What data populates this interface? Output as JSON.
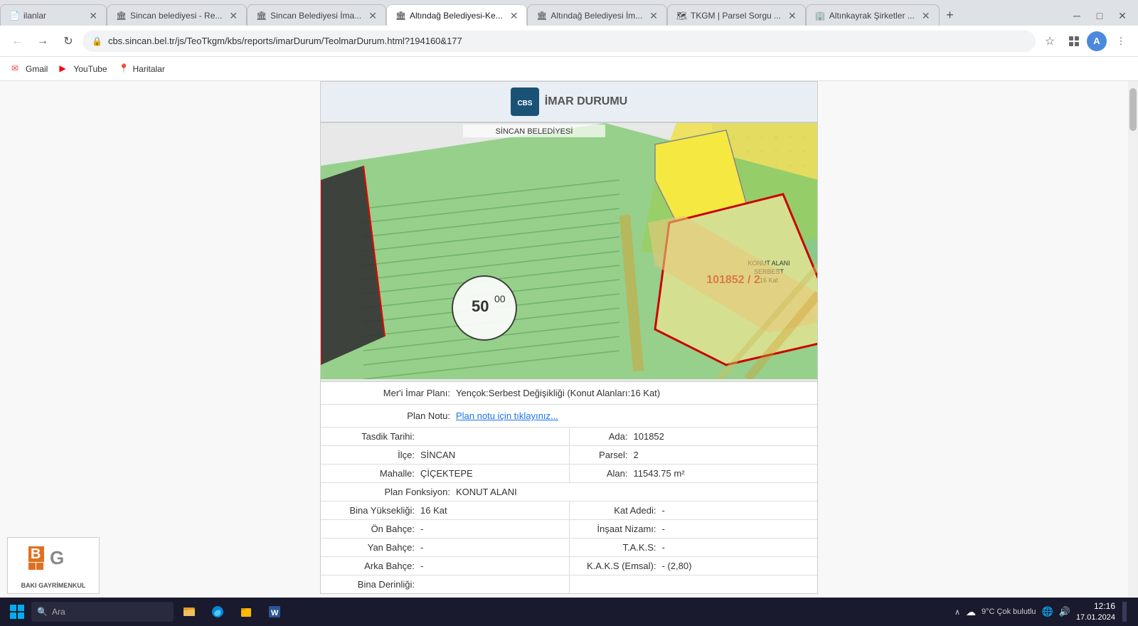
{
  "browser": {
    "tabs": [
      {
        "id": 1,
        "title": "ilanlar",
        "active": false,
        "favicon": "📄"
      },
      {
        "id": 2,
        "title": "Sincan belediyesi - Re...",
        "active": false,
        "favicon": "🏛"
      },
      {
        "id": 3,
        "title": "Sincan Belediyesi İma...",
        "active": false,
        "favicon": "🏛"
      },
      {
        "id": 4,
        "title": "Altındağ Belediyesi-Ke...",
        "active": true,
        "favicon": "🏛"
      },
      {
        "id": 5,
        "title": "Altındağ Belediyesi İm...",
        "active": false,
        "favicon": "🏛"
      },
      {
        "id": 6,
        "title": "TKGM | Parsel Sorgu ...",
        "active": false,
        "favicon": "🗺"
      },
      {
        "id": 7,
        "title": "Altınkayrak Şirketler ...",
        "active": false,
        "favicon": "🏢"
      }
    ],
    "address": "cbs.sincan.bel.tr/js/TeoTkgm/kbs/reports/imarDurum/TeolmarDurum.html?194160&177",
    "address_lock": "🔒"
  },
  "bookmarks": [
    {
      "label": "Gmail",
      "icon": "✉"
    },
    {
      "label": "YouTube",
      "icon": "▶"
    },
    {
      "label": "Haritalar",
      "icon": "📍"
    }
  ],
  "page": {
    "header_title": "İMAR DURUMU",
    "meri_imar_label": "Mer'i İmar Planı:",
    "meri_imar_value": "Yençok:Serbest Değişikliği (Konut Alanları:16 Kat)",
    "plan_notu_label": "Plan Notu:",
    "plan_notu_link": "Plan notu için tıklayınız...",
    "fields": {
      "left": [
        {
          "label": "Tasdik Tarihi:",
          "value": ""
        },
        {
          "label": "İlçe:",
          "value": "SİNCAN"
        },
        {
          "label": "Mahalle:",
          "value": "ÇİÇEKTEPE"
        }
      ],
      "right": [
        {
          "label": "Ada:",
          "value": "101852"
        },
        {
          "label": "Parsel:",
          "value": "2"
        },
        {
          "label": "Alan:",
          "value": "11543.75 m²"
        }
      ],
      "plan_fonksiyon_label": "Plan Fonksiyon:",
      "plan_fonksiyon_value": "KONUT ALANI",
      "bina_yukseklik_label": "Bina Yüksekliği:",
      "bina_yukseklik_value": "16 Kat",
      "on_bahce_label": "Ön Bahçe:",
      "on_bahce_value": "-",
      "yan_bahce_label": "Yan Bahçe:",
      "yan_bahce_value": "-",
      "arka_bahce_label": "Arka Bahçe:",
      "arka_bahce_value": "-",
      "bina_derinlik_label": "Bina Derinliği:",
      "bina_derinlik_value": "",
      "kat_adedi_label": "Kat Adedi:",
      "kat_adedi_value": "-",
      "insaat_nizami_label": "İnşaat Nizamı:",
      "insaat_nizami_value": "-",
      "taks_label": "T.A.K.S:",
      "taks_value": "-",
      "kaks_label": "K.A.K.S (Emsal):",
      "kaks_value": "- (2,80)"
    },
    "parcel_id": "101852 / 2",
    "scale_label": "50 00"
  },
  "taskbar": {
    "time": "12:16",
    "date": "17.01.2024",
    "weather": "9°C Çok bulutlu",
    "search_placeholder": "Ara"
  },
  "logo": {
    "text": "BAKI GAYRİMENKUL"
  }
}
